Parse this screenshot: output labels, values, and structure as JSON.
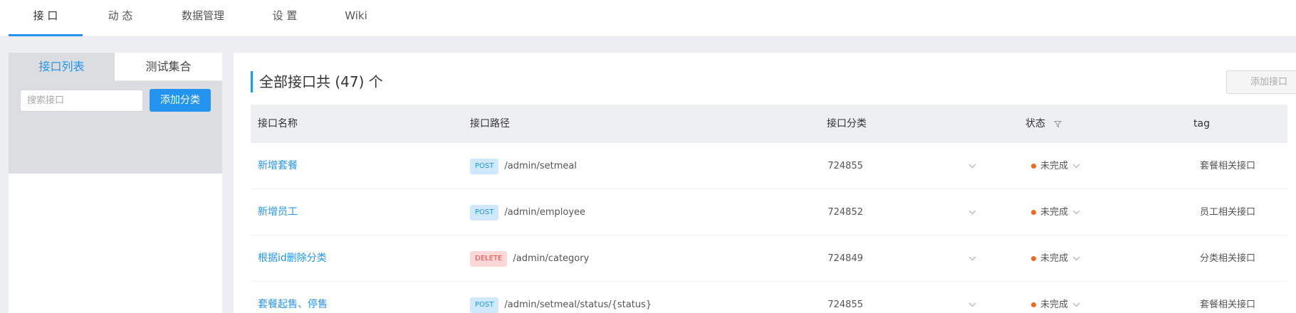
{
  "topnav": {
    "tabs": [
      "接 口",
      "动 态",
      "数据管理",
      "设 置",
      "Wiki"
    ]
  },
  "left_panel": {
    "tab_active": "接口列表",
    "tab_other": "测试集合",
    "search_placeholder": "搜索接口",
    "add_category_label": "添加分类"
  },
  "main": {
    "title": "全部接口共 (47) 个",
    "add_api_label": "添加接口",
    "columns": [
      "接口名称",
      "接口路径",
      "接口分类",
      "状态",
      "tag"
    ],
    "rows": [
      {
        "name": "新增套餐",
        "method": "POST",
        "path": "/admin/setmeal",
        "category": "724855",
        "status": "未完成",
        "tag": "套餐相关接口"
      },
      {
        "name": "新增员工",
        "method": "POST",
        "path": "/admin/employee",
        "category": "724852",
        "status": "未完成",
        "tag": "员工相关接口"
      },
      {
        "name": "根据id删除分类",
        "method": "DELETE",
        "path": "/admin/category",
        "category": "724849",
        "status": "未完成",
        "tag": "分类相关接口"
      },
      {
        "name": "套餐起售、停售",
        "method": "POST",
        "path": "/admin/setmeal/status/{status}",
        "category": "724855",
        "status": "未完成",
        "tag": "套餐相关接口"
      }
    ]
  },
  "colors": {
    "accent": "#2395f1",
    "status_dot": "#f5681c",
    "delete": "#f04a4a"
  }
}
